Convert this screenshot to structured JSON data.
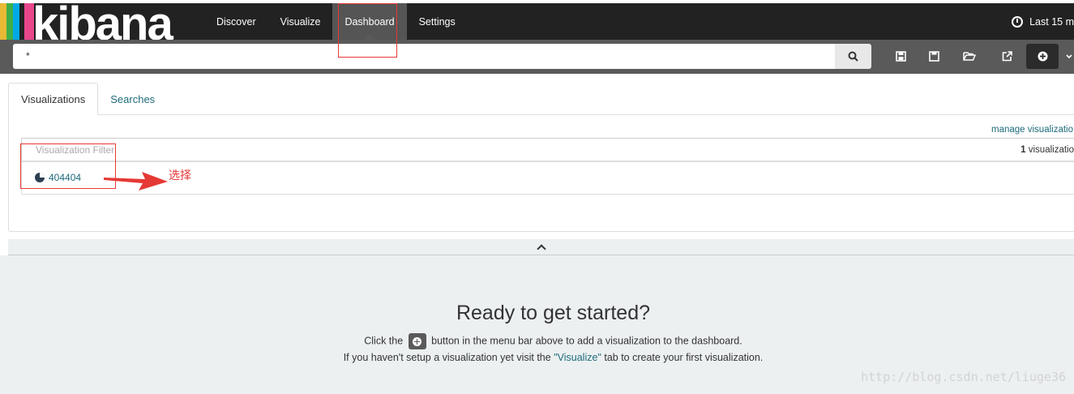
{
  "logo": {
    "text": "kibana",
    "stripe_colors": [
      "#e8b934",
      "#3fae49",
      "#00a9e5",
      "#e8478b"
    ]
  },
  "nav": {
    "items": [
      {
        "label": "Discover"
      },
      {
        "label": "Visualize"
      },
      {
        "label": "Dashboard",
        "active": true
      },
      {
        "label": "Settings"
      }
    ]
  },
  "timepicker": {
    "label": "Last 15 m"
  },
  "search": {
    "value": "*"
  },
  "toolbar": {
    "icons": [
      "new-dashboard-icon",
      "save-icon",
      "open-icon",
      "share-icon",
      "add-visualization-icon"
    ]
  },
  "panel": {
    "tabs": [
      {
        "label": "Visualizations",
        "active": true
      },
      {
        "label": "Searches"
      }
    ],
    "manage_link": "manage visualizatio",
    "filter_placeholder": "Visualization Filter",
    "count_number": "1",
    "count_label": " visualizatio",
    "items": [
      {
        "label": "404404",
        "icon": "pie-chart-icon"
      }
    ]
  },
  "annotation": {
    "note": "选择",
    "color": "#e53935"
  },
  "empty_dashboard": {
    "title": "Ready to get started?",
    "line1_before": "Click the ",
    "line1_after": " button in the menu bar above to add a visualization to the dashboard.",
    "line2_before": "If you haven't setup a visualization yet visit the ",
    "line2_link": "\"Visualize\"",
    "line2_after": " tab to create your first visualization."
  },
  "watermark": "http://blog.csdn.net/liuge36",
  "colors": {
    "nav_bg": "#222222",
    "search_bar_bg": "#5a5a5a",
    "link": "#1f6b7a",
    "dash_bg": "#ecf0f1"
  }
}
